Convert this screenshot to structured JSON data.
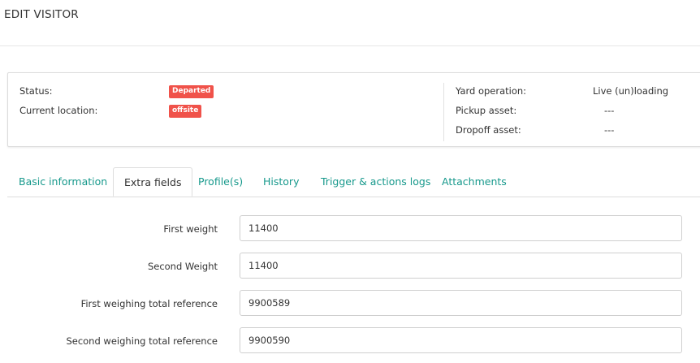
{
  "page": {
    "title": "EDIT VISITOR"
  },
  "info": {
    "status_label": "Status:",
    "status_value": "Departed",
    "location_label": "Current location:",
    "location_value": "offsite",
    "yard_operation_label": "Yard operation:",
    "yard_operation_value": "Live (un)loading",
    "pickup_asset_label": "Pickup asset:",
    "pickup_asset_value": "---",
    "dropoff_asset_label": "Dropoff asset:",
    "dropoff_asset_value": "---",
    "badge_color": "#f0524a"
  },
  "tabs": [
    {
      "label": "Basic information",
      "active": false
    },
    {
      "label": "Extra fields",
      "active": true
    },
    {
      "label": "Profile(s)",
      "active": false
    },
    {
      "label": "History",
      "active": false
    },
    {
      "label": "Trigger & actions logs",
      "active": false
    },
    {
      "label": "Attachments",
      "active": false
    }
  ],
  "form": {
    "fields": [
      {
        "label": "First weight",
        "value": "11400"
      },
      {
        "label": "Second Weight",
        "value": "11400"
      },
      {
        "label": "First weighing total reference",
        "value": "9900589"
      },
      {
        "label": "Second weighing total reference",
        "value": "9900590"
      }
    ]
  },
  "colors": {
    "tab_link": "#17998c",
    "text": "#333333"
  }
}
